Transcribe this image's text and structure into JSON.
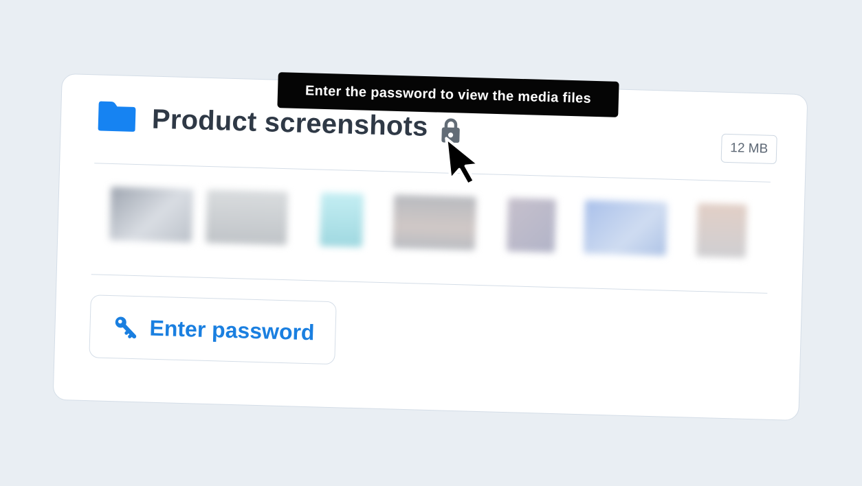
{
  "folder": {
    "icon": "folder-icon",
    "title": "Product screenshots",
    "lock_icon": "lock-icon",
    "size": "12 MB"
  },
  "tooltip": {
    "text": "Enter the password to view the media files"
  },
  "actions": {
    "enter_password_icon": "key-icon",
    "enter_password_label": "Enter password"
  },
  "colors": {
    "background": "#e9eef3",
    "accent": "#1a7fe0",
    "folder": "#1683f2",
    "lock": "#626c76",
    "title": "#2f3946",
    "tooltip_bg": "#050505"
  },
  "thumbnails": [
    {
      "label": "blurred-thumbnail-1",
      "color": "#bfc4cc"
    },
    {
      "label": "blurred-thumbnail-2",
      "color": "#c8ccd0"
    },
    {
      "label": "blurred-thumbnail-3",
      "color": "#b7e6ec"
    },
    {
      "label": "blurred-thumbnail-4",
      "color": "#c5c7cc"
    },
    {
      "label": "blurred-thumbnail-5",
      "color": "#c8c9d6"
    },
    {
      "label": "blurred-thumbnail-6",
      "color": "#b6cbe9"
    },
    {
      "label": "blurred-thumbnail-7",
      "color": "#d8d2ce"
    }
  ]
}
